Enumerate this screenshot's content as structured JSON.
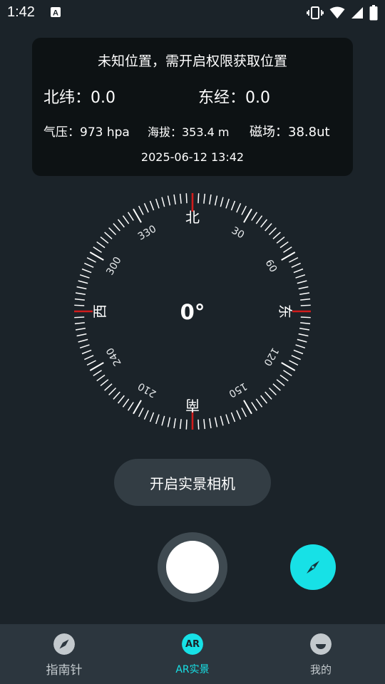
{
  "status": {
    "time": "1:42"
  },
  "info": {
    "title": "未知位置，需开启权限获取位置",
    "latitude": "北纬：0.0",
    "longitude": "东经：0.0",
    "pressure": "气压：973 hpa",
    "altitude": "海拔：353.4 m",
    "magnetic": "磁场：38.8ut",
    "datetime": "2025-06-12 13:42"
  },
  "compass": {
    "heading": "0°",
    "north": "北",
    "east": "东",
    "south": "南",
    "west": "西",
    "degree_labels": [
      "30",
      "60",
      "120",
      "150",
      "210",
      "240",
      "300",
      "330"
    ],
    "accent_color": "#d01c1c"
  },
  "camera_button_label": "开启实景相机",
  "nav": {
    "items": [
      {
        "label": "指南针",
        "icon": "compass-icon",
        "active": false
      },
      {
        "label": "AR实景",
        "icon_text": "AR",
        "icon": "ar-icon",
        "active": true
      },
      {
        "label": "我的",
        "icon": "profile-icon",
        "active": false
      }
    ]
  },
  "colors": {
    "accent": "#17e1e6",
    "background": "#1b2329",
    "card": "#0d1214"
  }
}
